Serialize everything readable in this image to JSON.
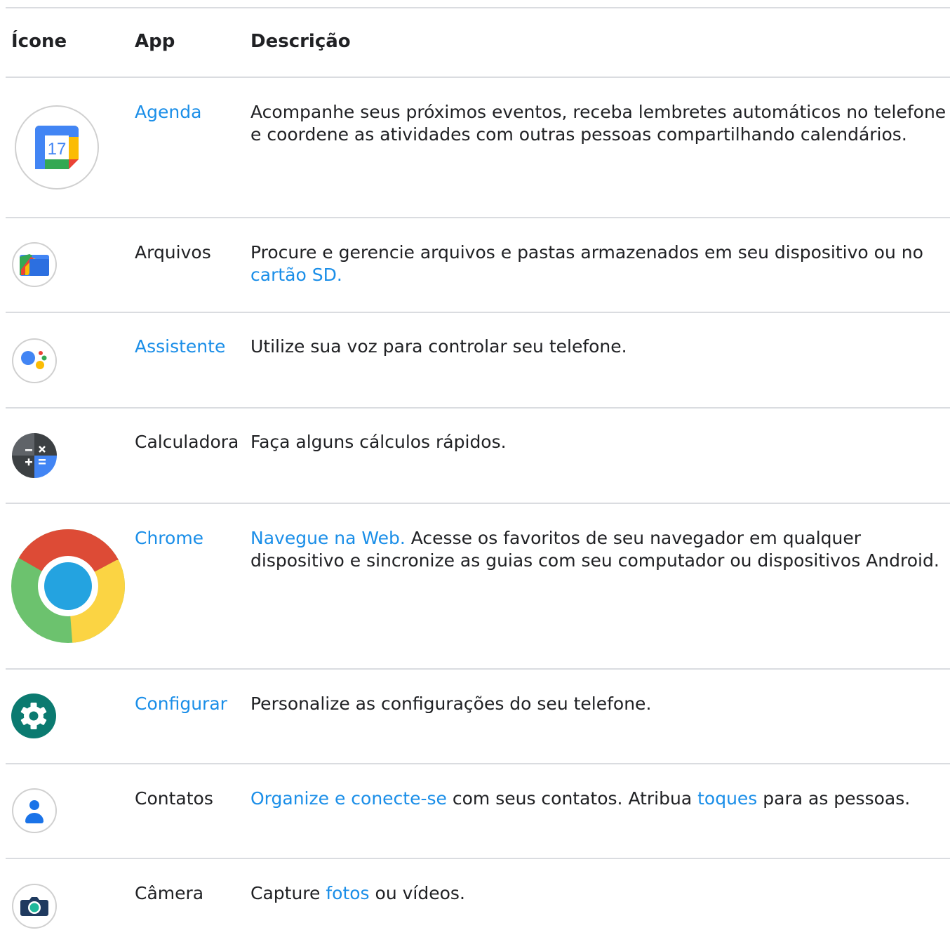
{
  "header": {
    "icon": "Ícone",
    "app": "App",
    "description": "Descrição"
  },
  "rows": [
    {
      "icon": "calendar-icon",
      "app": "Agenda",
      "app_link": true,
      "description": {
        "before": "Acompanhe seus próximos eventos, receba lembretes automáticos no telefone e coordene as atividades com outras pessoas compartilhando calendários."
      },
      "icon_text": "17"
    },
    {
      "icon": "files-icon",
      "app": "Arquivos",
      "app_link": false,
      "description": {
        "before": "Procure e gerencie arquivos e pastas armazenados em seu dispositivo ou no ",
        "link": "cartão SD."
      }
    },
    {
      "icon": "assistant-icon",
      "app": "Assistente",
      "app_link": true,
      "description": {
        "before": "Utilize sua voz para controlar seu telefone."
      }
    },
    {
      "icon": "calculator-icon",
      "app": "Calculadora",
      "app_link": false,
      "description": {
        "before": "Faça alguns cálculos rápidos."
      }
    },
    {
      "icon": "chrome-icon",
      "app": "Chrome",
      "app_link": true,
      "description": {
        "link": "Navegue na Web.",
        "after": " Acesse os favoritos de seu navegador em qualquer dispositivo e sincronize as guias com seu computador ou dispositivos Android."
      }
    },
    {
      "icon": "settings-icon",
      "app": "Configurar",
      "app_link": true,
      "description": {
        "before": "Personalize as configurações do seu telefone."
      }
    },
    {
      "icon": "contacts-icon",
      "app": "Contatos",
      "app_link": false,
      "description": {
        "link": "Organize e conecte-se",
        "after": " com seus contatos. Atribua ",
        "link2": "toques",
        "after2": " para as pessoas."
      }
    },
    {
      "icon": "camera-icon",
      "app": "Câmera",
      "app_link": false,
      "description": {
        "before": "Capture ",
        "link": "fotos",
        "after": " ou vídeos."
      }
    }
  ],
  "colors": {
    "link": "#1a8ee8",
    "rule": "#dadce0",
    "text": "#202124"
  }
}
